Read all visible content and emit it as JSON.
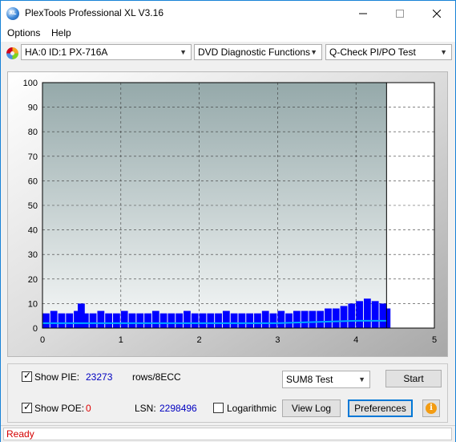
{
  "window": {
    "title": "PlexTools Professional XL V3.16",
    "icon_text": "XL"
  },
  "menu": {
    "options": "Options",
    "help": "Help"
  },
  "toolbar": {
    "drive": "HA:0 ID:1  PX-716A",
    "function": "DVD Diagnostic Functions",
    "test": "Q-Check PI/PO Test"
  },
  "chart_data": {
    "type": "bar",
    "title": "",
    "xlabel": "",
    "ylabel": "",
    "xlim": [
      0,
      5
    ],
    "ylim": [
      0,
      100
    ],
    "x_ticks": [
      "0",
      "1",
      "2",
      "3",
      "4",
      "5"
    ],
    "y_ticks": [
      "0",
      "10",
      "20",
      "30",
      "40",
      "50",
      "60",
      "70",
      "80",
      "90",
      "100"
    ],
    "data_end_x": 4.39,
    "grid": true,
    "series": [
      {
        "type": "bar",
        "color": "#0000ff",
        "x": [
          0.0,
          0.1,
          0.2,
          0.3,
          0.4,
          0.45,
          0.5,
          0.6,
          0.7,
          0.8,
          0.9,
          1.0,
          1.1,
          1.2,
          1.3,
          1.4,
          1.5,
          1.6,
          1.7,
          1.8,
          1.9,
          2.0,
          2.1,
          2.2,
          2.3,
          2.4,
          2.5,
          2.6,
          2.7,
          2.8,
          2.9,
          3.0,
          3.1,
          3.2,
          3.3,
          3.4,
          3.5,
          3.6,
          3.7,
          3.8,
          3.9,
          4.0,
          4.1,
          4.2,
          4.3,
          4.35
        ],
        "y": [
          6,
          7,
          6,
          6,
          7,
          10,
          6,
          6,
          7,
          6,
          6,
          7,
          6,
          6,
          6,
          7,
          6,
          6,
          6,
          7,
          6,
          6,
          6,
          6,
          7,
          6,
          6,
          6,
          6,
          7,
          6,
          7,
          6,
          7,
          7,
          7,
          7,
          8,
          8,
          9,
          10,
          11,
          12,
          11,
          10,
          8
        ]
      },
      {
        "type": "line",
        "color": "#00aaff",
        "x": [
          0.0,
          0.5,
          1.0,
          1.5,
          2.0,
          2.5,
          3.0,
          3.5,
          4.0,
          4.39
        ],
        "y": [
          2,
          2,
          2,
          2,
          2,
          2,
          2,
          2.5,
          3,
          3
        ]
      }
    ]
  },
  "bottom": {
    "show_pie_label": "Show PIE:",
    "pie_value": "23273",
    "pie_unit": "rows/8ECC",
    "show_poe_label": "Show POE:",
    "poe_value": "0",
    "lsn_label": "LSN:",
    "lsn_value": "2298496",
    "log_label": "Logarithmic",
    "mode": "SUM8 Test",
    "start_label": "Start",
    "viewlog_label": "View Log",
    "prefs_label": "Preferences"
  },
  "status": {
    "text": "Ready"
  },
  "colors": {
    "value_blue": "#0000c0",
    "value_red": "#e00000",
    "status_red": "#d40000",
    "accent": "#0078d7"
  }
}
